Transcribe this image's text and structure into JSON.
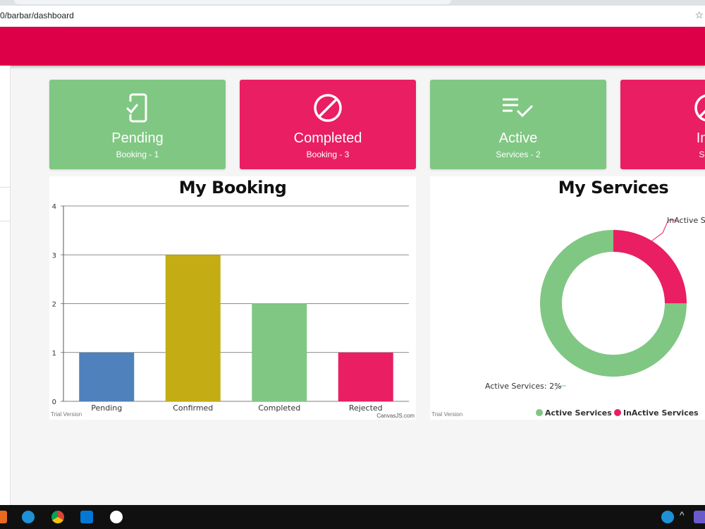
{
  "browser": {
    "url": "0/barbar/dashboard"
  },
  "cards": [
    {
      "title": "Pending",
      "sub": "Booking - 1",
      "color": "#80c783",
      "icon": "phone-check-icon"
    },
    {
      "title": "Completed",
      "sub": "Booking - 3",
      "color": "#e91e63",
      "icon": "block-icon"
    },
    {
      "title": "Active",
      "sub": "Services - 2",
      "color": "#80c783",
      "icon": "list-check-icon"
    },
    {
      "title": "In A",
      "sub": "Servi",
      "color": "#e91e63",
      "icon": "block-icon"
    }
  ],
  "booking_chart": {
    "title": "My Booking",
    "trial": "Trial Version",
    "credit": "CanvasJS.com"
  },
  "services_chart": {
    "title": "My Services",
    "trial": "Trial Version",
    "active_label": "Active Services: 2%",
    "inactive_label": "InActive S"
  },
  "chart_data": [
    {
      "type": "bar",
      "title": "My Booking",
      "categories": [
        "Pending",
        "Confirmed",
        "Completed",
        "Rejected"
      ],
      "values": [
        1,
        3,
        2,
        1
      ],
      "colors": [
        "#4f81bc",
        "#c4ac14",
        "#80c783",
        "#e91e63"
      ],
      "ylim": [
        0,
        4
      ],
      "yticks": [
        "0",
        "1",
        "2",
        "3",
        "4"
      ],
      "grid": true
    },
    {
      "type": "pie",
      "title": "My Services",
      "categories": [
        "Active Services",
        "InActive Services"
      ],
      "values": [
        75,
        25
      ],
      "colors": [
        "#80c783",
        "#e91e63"
      ],
      "legend": "bottom"
    }
  ]
}
